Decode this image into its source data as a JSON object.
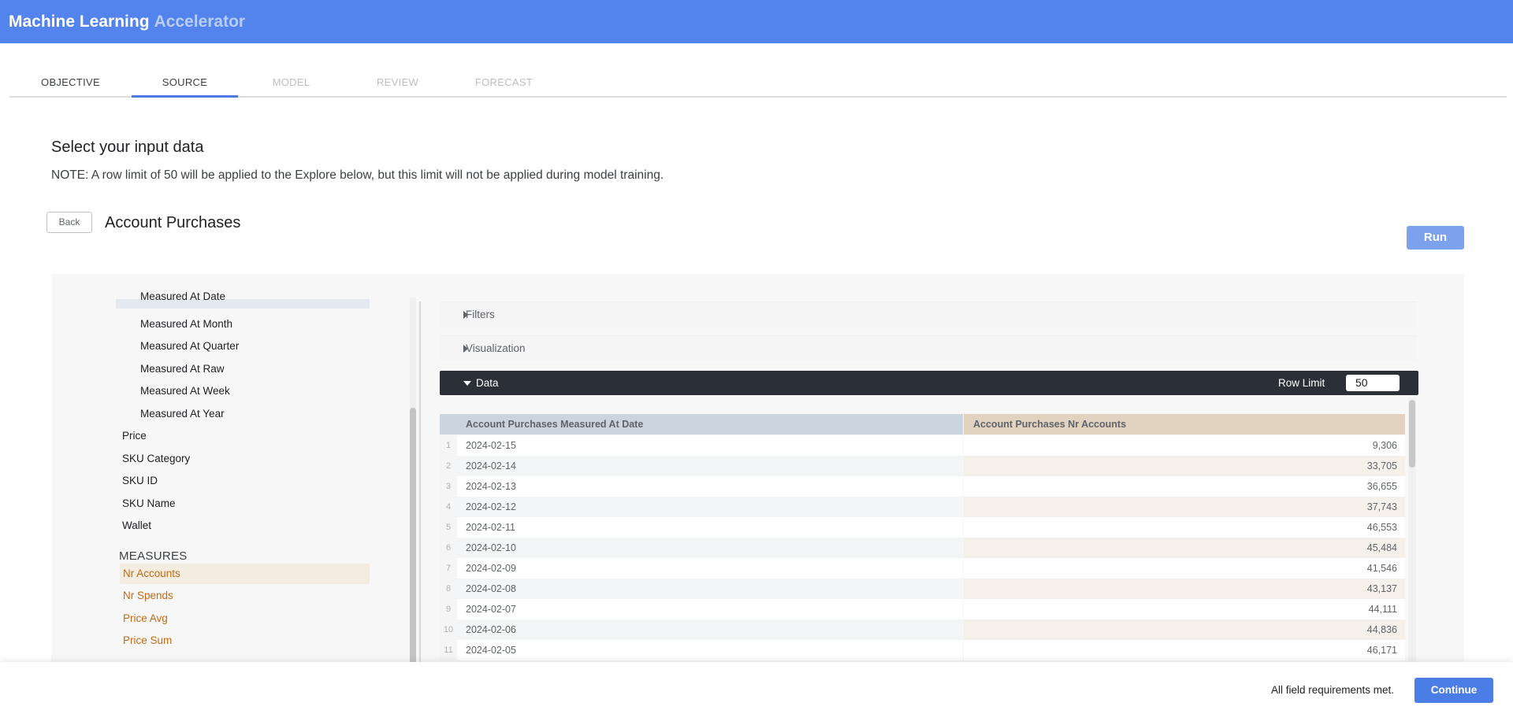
{
  "app": {
    "title_main": "Machine Learning",
    "title_accent": "Accelerator"
  },
  "tabs": [
    {
      "label": "OBJECTIVE",
      "state": "done"
    },
    {
      "label": "SOURCE",
      "state": "active"
    },
    {
      "label": "MODEL",
      "state": "disabled"
    },
    {
      "label": "REVIEW",
      "state": "disabled"
    },
    {
      "label": "FORECAST",
      "state": "disabled"
    }
  ],
  "source": {
    "heading": "Select your input data",
    "note": "NOTE: A row limit of 50 will be applied to the Explore below, but this limit will not be applied during model training.",
    "back_label": "Back",
    "explore_title": "Account Purchases",
    "run_label": "Run"
  },
  "field_picker": {
    "dimension_timeframes": [
      "Measured At Date",
      "Measured At Month",
      "Measured At Quarter",
      "Measured At Raw",
      "Measured At Week",
      "Measured At Year"
    ],
    "dimensions": [
      "Price",
      "SKU Category",
      "SKU ID",
      "SKU Name",
      "Wallet"
    ],
    "measures_heading": "MEASURES",
    "measures": [
      "Nr Accounts",
      "Nr Spends",
      "Price Avg",
      "Price Sum"
    ]
  },
  "explore": {
    "filters_label": "Filters",
    "visualization_label": "Visualization",
    "data_label": "Data",
    "row_limit_label": "Row Limit",
    "row_limit_value": "50"
  },
  "results": {
    "columns": [
      "Account Purchases Measured At Date",
      "Account Purchases Nr Accounts"
    ],
    "rows": [
      {
        "n": "1",
        "date": "2024-02-15",
        "value": "9,306"
      },
      {
        "n": "2",
        "date": "2024-02-14",
        "value": "33,705"
      },
      {
        "n": "3",
        "date": "2024-02-13",
        "value": "36,655"
      },
      {
        "n": "4",
        "date": "2024-02-12",
        "value": "37,743"
      },
      {
        "n": "5",
        "date": "2024-02-11",
        "value": "46,553"
      },
      {
        "n": "6",
        "date": "2024-02-10",
        "value": "45,484"
      },
      {
        "n": "7",
        "date": "2024-02-09",
        "value": "41,546"
      },
      {
        "n": "8",
        "date": "2024-02-08",
        "value": "43,137"
      },
      {
        "n": "9",
        "date": "2024-02-07",
        "value": "44,111"
      },
      {
        "n": "10",
        "date": "2024-02-06",
        "value": "44,836"
      },
      {
        "n": "11",
        "date": "2024-02-05",
        "value": "46,171"
      }
    ]
  },
  "footer": {
    "status": "All field requirements met.",
    "continue_label": "Continue"
  },
  "colors": {
    "header": "#5383ec",
    "accent": "#4a7ee6",
    "measure_text": "#c26a12",
    "data_bar": "#2b2f36"
  }
}
